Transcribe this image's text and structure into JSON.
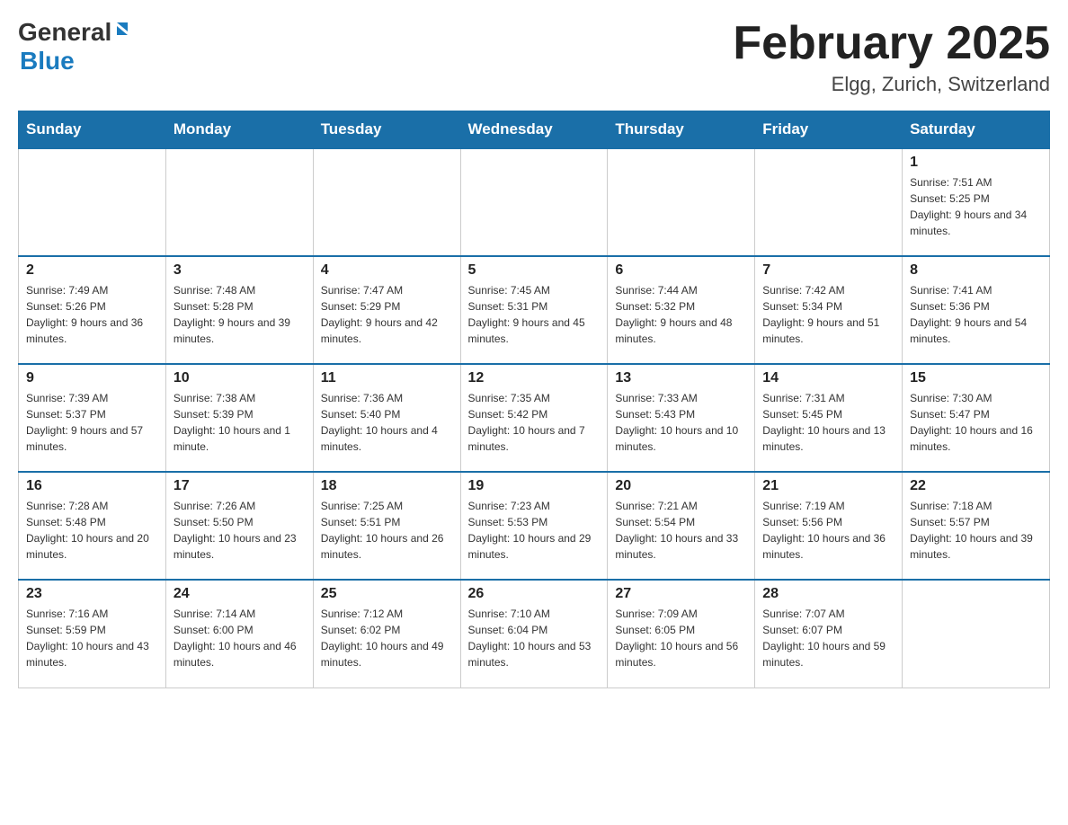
{
  "header": {
    "logo_general": "General",
    "logo_blue": "Blue",
    "month_title": "February 2025",
    "location": "Elgg, Zurich, Switzerland"
  },
  "weekdays": [
    "Sunday",
    "Monday",
    "Tuesday",
    "Wednesday",
    "Thursday",
    "Friday",
    "Saturday"
  ],
  "weeks": [
    [
      {
        "day": "",
        "info": ""
      },
      {
        "day": "",
        "info": ""
      },
      {
        "day": "",
        "info": ""
      },
      {
        "day": "",
        "info": ""
      },
      {
        "day": "",
        "info": ""
      },
      {
        "day": "",
        "info": ""
      },
      {
        "day": "1",
        "info": "Sunrise: 7:51 AM\nSunset: 5:25 PM\nDaylight: 9 hours and 34 minutes."
      }
    ],
    [
      {
        "day": "2",
        "info": "Sunrise: 7:49 AM\nSunset: 5:26 PM\nDaylight: 9 hours and 36 minutes."
      },
      {
        "day": "3",
        "info": "Sunrise: 7:48 AM\nSunset: 5:28 PM\nDaylight: 9 hours and 39 minutes."
      },
      {
        "day": "4",
        "info": "Sunrise: 7:47 AM\nSunset: 5:29 PM\nDaylight: 9 hours and 42 minutes."
      },
      {
        "day": "5",
        "info": "Sunrise: 7:45 AM\nSunset: 5:31 PM\nDaylight: 9 hours and 45 minutes."
      },
      {
        "day": "6",
        "info": "Sunrise: 7:44 AM\nSunset: 5:32 PM\nDaylight: 9 hours and 48 minutes."
      },
      {
        "day": "7",
        "info": "Sunrise: 7:42 AM\nSunset: 5:34 PM\nDaylight: 9 hours and 51 minutes."
      },
      {
        "day": "8",
        "info": "Sunrise: 7:41 AM\nSunset: 5:36 PM\nDaylight: 9 hours and 54 minutes."
      }
    ],
    [
      {
        "day": "9",
        "info": "Sunrise: 7:39 AM\nSunset: 5:37 PM\nDaylight: 9 hours and 57 minutes."
      },
      {
        "day": "10",
        "info": "Sunrise: 7:38 AM\nSunset: 5:39 PM\nDaylight: 10 hours and 1 minute."
      },
      {
        "day": "11",
        "info": "Sunrise: 7:36 AM\nSunset: 5:40 PM\nDaylight: 10 hours and 4 minutes."
      },
      {
        "day": "12",
        "info": "Sunrise: 7:35 AM\nSunset: 5:42 PM\nDaylight: 10 hours and 7 minutes."
      },
      {
        "day": "13",
        "info": "Sunrise: 7:33 AM\nSunset: 5:43 PM\nDaylight: 10 hours and 10 minutes."
      },
      {
        "day": "14",
        "info": "Sunrise: 7:31 AM\nSunset: 5:45 PM\nDaylight: 10 hours and 13 minutes."
      },
      {
        "day": "15",
        "info": "Sunrise: 7:30 AM\nSunset: 5:47 PM\nDaylight: 10 hours and 16 minutes."
      }
    ],
    [
      {
        "day": "16",
        "info": "Sunrise: 7:28 AM\nSunset: 5:48 PM\nDaylight: 10 hours and 20 minutes."
      },
      {
        "day": "17",
        "info": "Sunrise: 7:26 AM\nSunset: 5:50 PM\nDaylight: 10 hours and 23 minutes."
      },
      {
        "day": "18",
        "info": "Sunrise: 7:25 AM\nSunset: 5:51 PM\nDaylight: 10 hours and 26 minutes."
      },
      {
        "day": "19",
        "info": "Sunrise: 7:23 AM\nSunset: 5:53 PM\nDaylight: 10 hours and 29 minutes."
      },
      {
        "day": "20",
        "info": "Sunrise: 7:21 AM\nSunset: 5:54 PM\nDaylight: 10 hours and 33 minutes."
      },
      {
        "day": "21",
        "info": "Sunrise: 7:19 AM\nSunset: 5:56 PM\nDaylight: 10 hours and 36 minutes."
      },
      {
        "day": "22",
        "info": "Sunrise: 7:18 AM\nSunset: 5:57 PM\nDaylight: 10 hours and 39 minutes."
      }
    ],
    [
      {
        "day": "23",
        "info": "Sunrise: 7:16 AM\nSunset: 5:59 PM\nDaylight: 10 hours and 43 minutes."
      },
      {
        "day": "24",
        "info": "Sunrise: 7:14 AM\nSunset: 6:00 PM\nDaylight: 10 hours and 46 minutes."
      },
      {
        "day": "25",
        "info": "Sunrise: 7:12 AM\nSunset: 6:02 PM\nDaylight: 10 hours and 49 minutes."
      },
      {
        "day": "26",
        "info": "Sunrise: 7:10 AM\nSunset: 6:04 PM\nDaylight: 10 hours and 53 minutes."
      },
      {
        "day": "27",
        "info": "Sunrise: 7:09 AM\nSunset: 6:05 PM\nDaylight: 10 hours and 56 minutes."
      },
      {
        "day": "28",
        "info": "Sunrise: 7:07 AM\nSunset: 6:07 PM\nDaylight: 10 hours and 59 minutes."
      },
      {
        "day": "",
        "info": ""
      }
    ]
  ]
}
